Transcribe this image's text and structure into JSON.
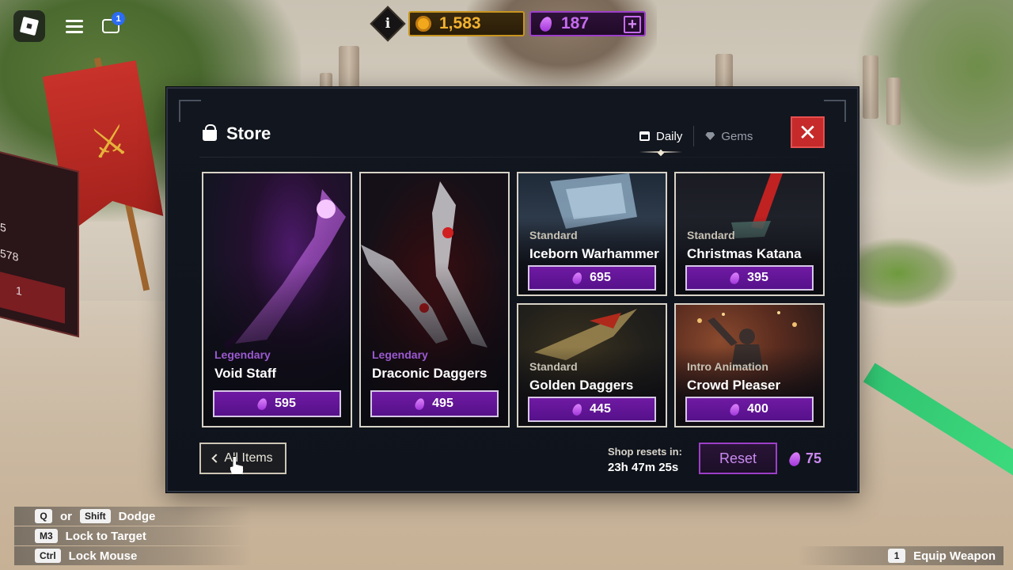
{
  "hud": {
    "coins": "1,583",
    "gems": "187",
    "chat_badge": "1",
    "info_label": "i",
    "plus_label": "+"
  },
  "store": {
    "title": "Store",
    "tabs": [
      {
        "label": "Daily",
        "active": true,
        "icon": "calendar-icon"
      },
      {
        "label": "Gems",
        "active": false,
        "icon": "gem-icon"
      }
    ],
    "close_label": "✕",
    "items": [
      {
        "rarity": "Legendary",
        "name": "Void Staff",
        "price": "595"
      },
      {
        "rarity": "Legendary",
        "name": "Draconic Daggers",
        "price": "495"
      },
      {
        "rarity": "Standard",
        "name": "Iceborn Warhammer",
        "price": "695"
      },
      {
        "rarity": "Standard",
        "name": "Christmas Katana",
        "price": "395"
      },
      {
        "rarity": "Standard",
        "name": "Golden Daggers",
        "price": "445"
      },
      {
        "rarity": "Intro Animation",
        "name": "Crowd Pleaser",
        "price": "400"
      }
    ],
    "all_items_label": "All Items",
    "shop_reset_label": "Shop resets in:",
    "shop_reset_time": "23h 47m 25s",
    "reset_label": "Reset",
    "reset_cost": "75"
  },
  "keybinds": {
    "dodge": {
      "key1": "Q",
      "or": "or",
      "key2": "Shift",
      "label": "Dodge"
    },
    "lock_target": {
      "key": "M3",
      "label": "Lock to Target"
    },
    "lock_mouse": {
      "key": "Ctrl",
      "label": "Lock Mouse"
    },
    "equip": {
      "key": "1",
      "label": "Equip Weapon"
    }
  },
  "scene": {
    "left_board_lines": [
      "5",
      "578",
      "1"
    ]
  },
  "colors": {
    "gem_purple": "#9d3fc9",
    "coin_gold": "#f2b230",
    "close_red": "#c62a2a",
    "legendary": "#9b5ad1"
  }
}
